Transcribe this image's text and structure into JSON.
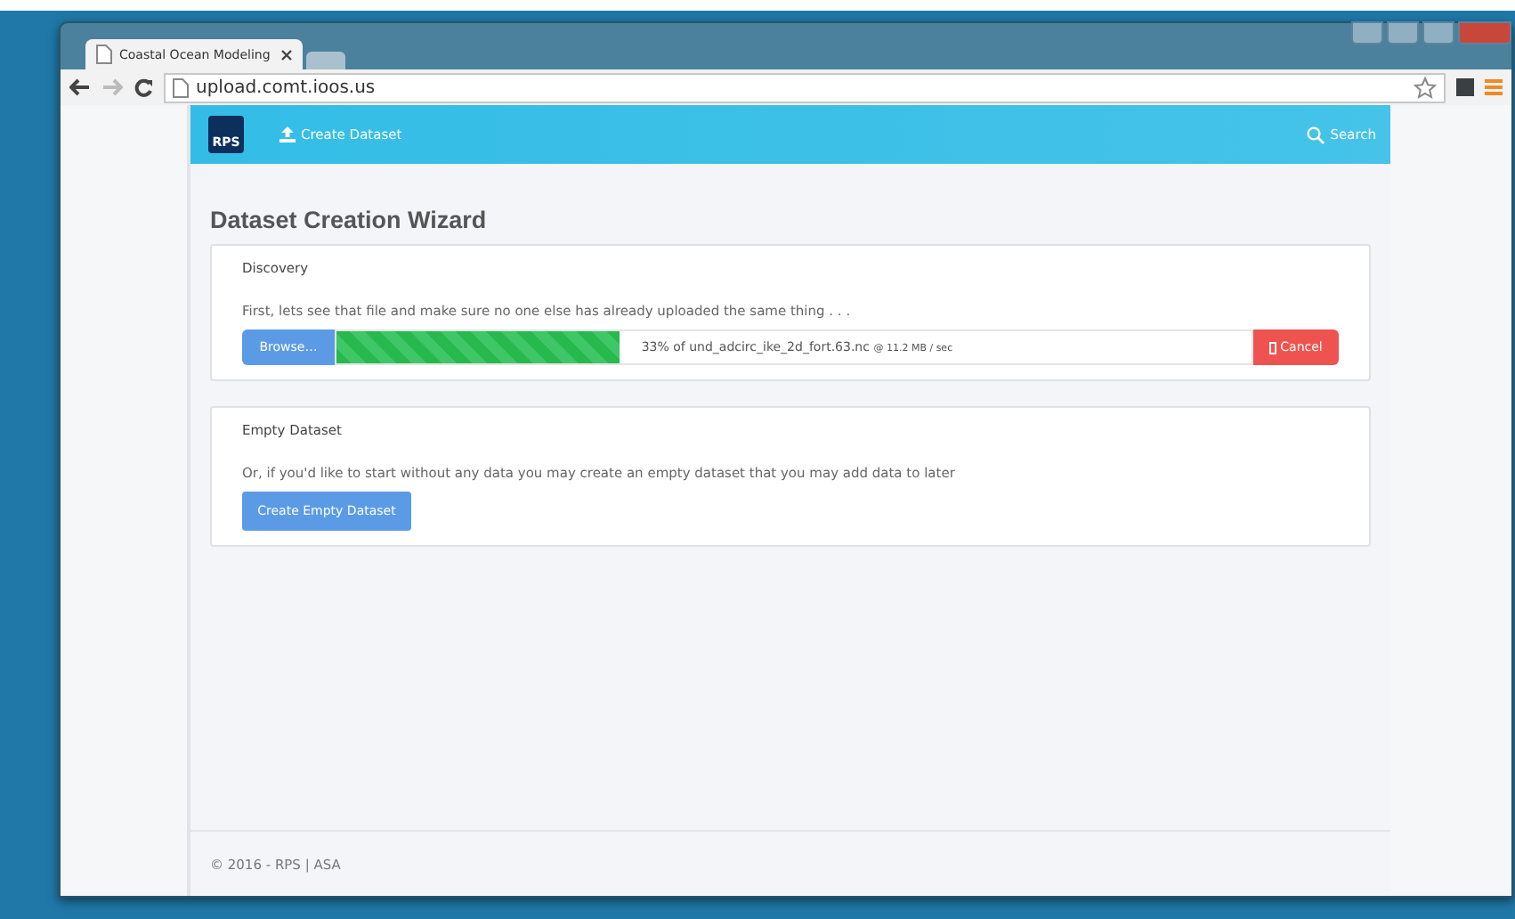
{
  "browser": {
    "tabs": [
      {
        "title": "Coastal Ocean Modeling",
        "selected": true
      },
      {
        "selected": false
      }
    ],
    "url": "upload.comt.ioos.us"
  },
  "navbar": {
    "logo": "RPS",
    "create_link": "Create Dataset",
    "search_link": "Search"
  },
  "page_title": "Dataset Creation Wizard",
  "discovery": {
    "heading": "Discovery",
    "text": "First, lets see that file and make sure no one else has already uploaded the same thing . . .",
    "browse_button": "Browse…",
    "upload": {
      "level": 0.31,
      "status": "33% of und_adcirc_ike_2d_fort.63.nc",
      "rate": "@ 11.2 MB / sec"
    },
    "cancel_button": "Cancel"
  },
  "empty_dataset": {
    "heading": "Empty Dataset",
    "text": "Or, if you'd like to start without any data you may create an empty dataset that you may add data to later",
    "button": "Create Empty Dataset"
  },
  "footer": "© 2016 - RPS | ASA"
}
